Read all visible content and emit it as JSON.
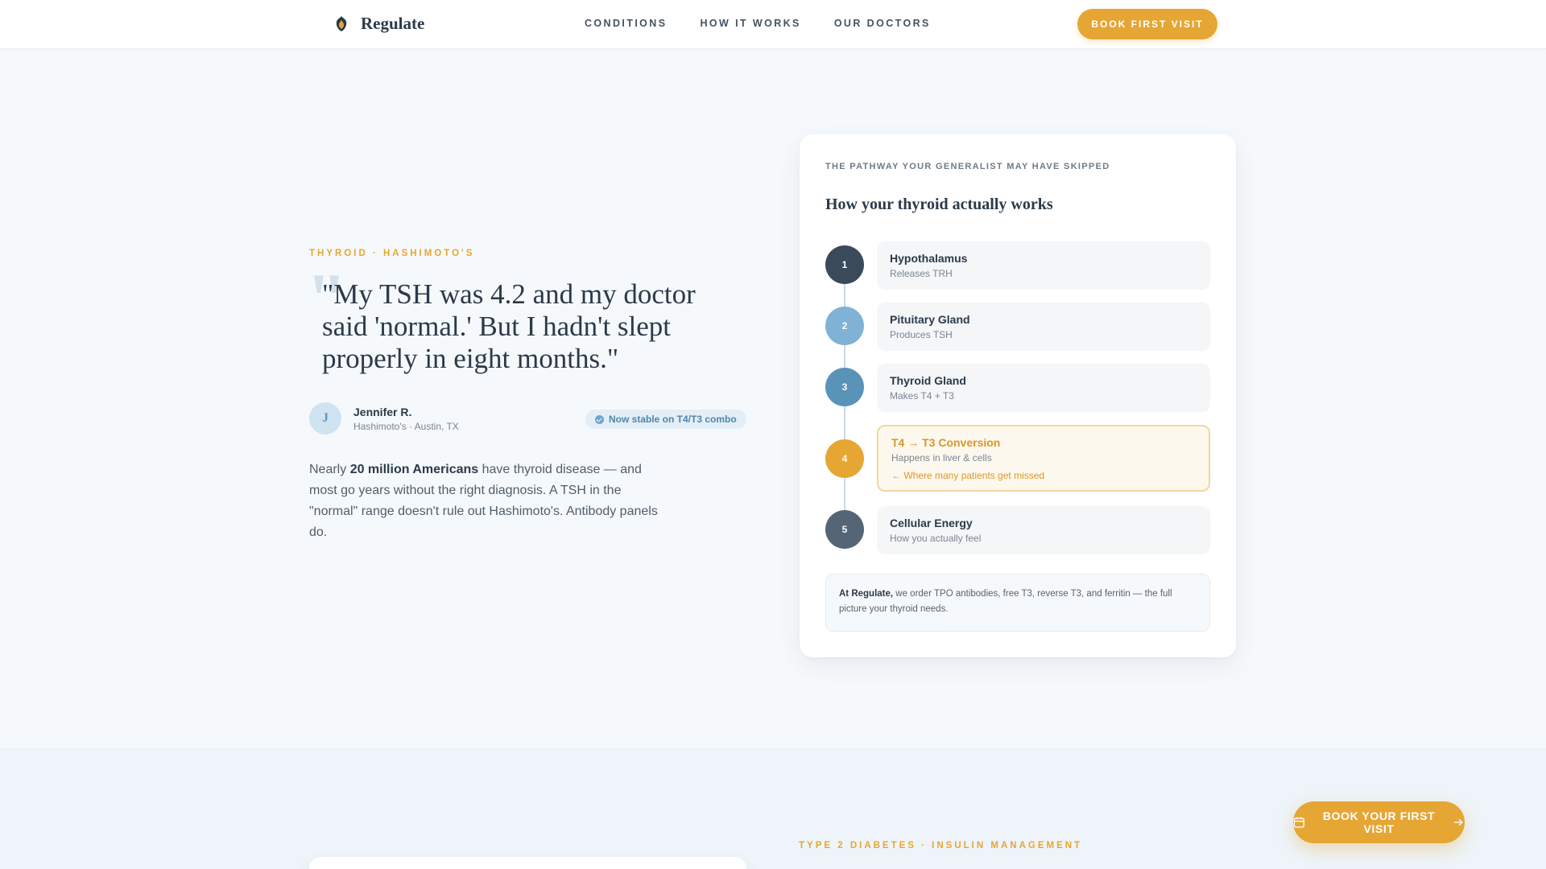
{
  "header": {
    "brand": "Regulate",
    "nav": [
      "CONDITIONS",
      "HOW IT WORKS",
      "OUR DOCTORS"
    ],
    "cta_label": "BOOK FIRST VISIT"
  },
  "testimonial": {
    "eyebrow": "THYROID · HASHIMOTO'S",
    "quote_mark": "\"",
    "quote": "\"My TSH was 4.2 and my doctor said 'normal.' But I hadn't slept properly in eight months.\"",
    "author": {
      "initial": "J",
      "name": "Jennifer R.",
      "meta": "Hashimoto's · Austin, TX"
    },
    "badge": "Now stable on T4/T3 combo",
    "body": {
      "prefix": "Nearly ",
      "bold": "20 million Americans",
      "suffix": " have thyroid disease — and most go years without the right diagnosis. A TSH in the \"normal\" range doesn't rule out Hashimoto's. Antibody panels do."
    }
  },
  "pathway_card": {
    "eyebrow": "THE PATHWAY YOUR GENERALIST MAY HAVE SKIPPED",
    "title": "How your thyroid actually works",
    "steps": [
      {
        "number": "1",
        "title": "Hypothalamus",
        "subtitle": "Releases TRH",
        "color": "#3a4a5a"
      },
      {
        "number": "2",
        "title": "Pituitary Gland",
        "subtitle": "Produces TSH",
        "color": "#7fb2d4"
      },
      {
        "number": "3",
        "title": "Thyroid Gland",
        "subtitle": "Makes T4 + T3",
        "color": "#5a93b8"
      },
      {
        "number": "4",
        "title": "T4 → T3 Conversion",
        "subtitle": "Happens in liver & cells",
        "note": "← Where many patients get missed",
        "color": "#e6a634"
      },
      {
        "number": "5",
        "title": "Cellular Energy",
        "subtitle": "How you actually feel",
        "color": "#556575"
      }
    ],
    "note": {
      "bold": "At Regulate,",
      "text": " we order TPO antibodies, free T3, reverse T3, and ferritin — the full picture your thyroid needs."
    }
  },
  "next_section": {
    "eyebrow": "TYPE 2 DIABETES · INSULIN MANAGEMENT"
  },
  "floating_cta": {
    "label": "BOOK YOUR FIRST VISIT",
    "icon": "calendar-icon",
    "arrow_icon": "arrow-right-icon"
  },
  "colors": {
    "accent": "#e6a634",
    "text_dark": "#2b3a4a",
    "blue": "#5a93b8"
  }
}
